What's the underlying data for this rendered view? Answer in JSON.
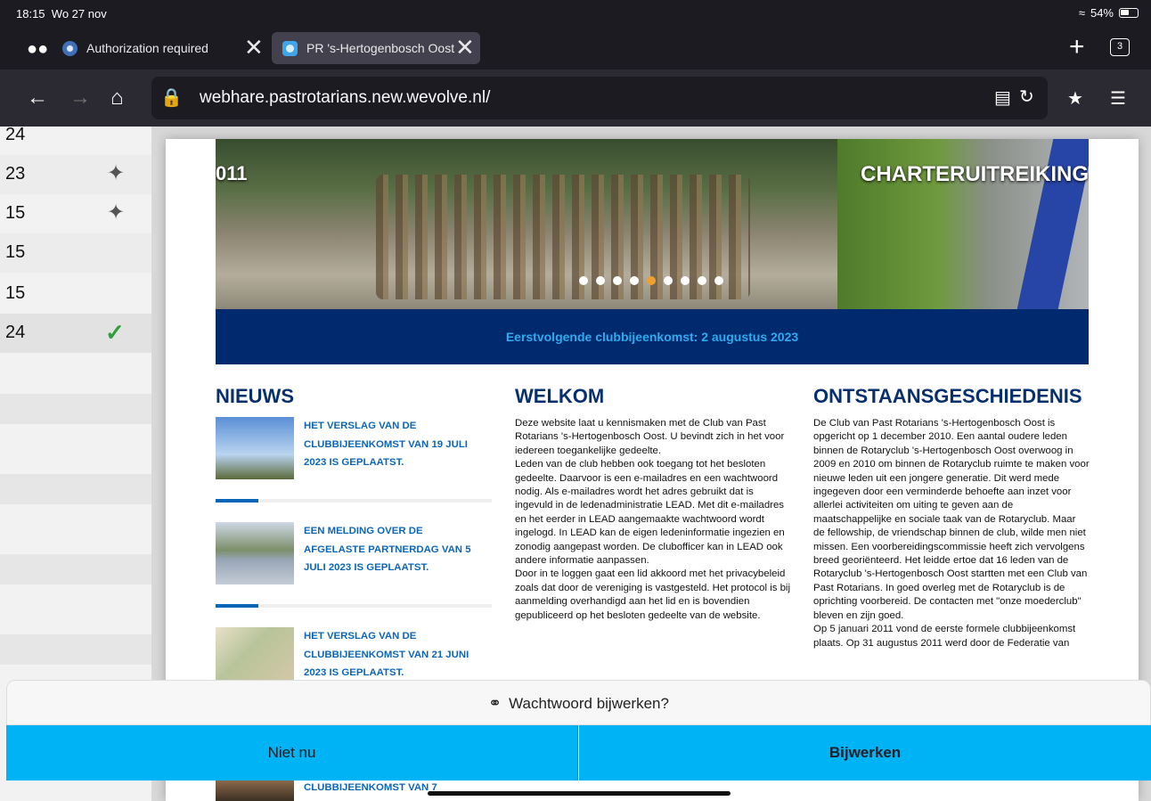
{
  "status": {
    "time": "18:15",
    "date": "Wo 27 nov",
    "battery": "54%"
  },
  "tabs": [
    {
      "label": "Authorization required"
    },
    {
      "label": "PR 's-Hertogenbosch Oost"
    }
  ],
  "tab_count": "3",
  "toolbar": {
    "url": "webhare.pastrotarians.new.wevolve.nl/"
  },
  "sidebar": {
    "rows": [
      {
        "num": "24",
        "icon": ""
      },
      {
        "num": "23",
        "icon": "pin-icon"
      },
      {
        "num": "15",
        "icon": "pin-icon"
      },
      {
        "num": "15",
        "icon": ""
      },
      {
        "num": "15",
        "icon": ""
      },
      {
        "num": "24",
        "icon": "check-icon"
      }
    ]
  },
  "hero": {
    "left_text": "011",
    "right_text": "CHARTERUITREIKING",
    "slide_count": 9,
    "active_slide": 5
  },
  "banner": "Eerstvolgende clubbijeenkomst: 2 augustus 2023",
  "news": {
    "heading": "NIEUWS",
    "items": [
      {
        "title": "HET VERSLAG VAN DE CLUBBIJEENKOMST VAN 19 JULI 2023 IS GEPLAATST."
      },
      {
        "title": "EEN MELDING OVER DE AFGELASTE PARTNERDAG VAN 5 JULI 2023 IS GEPLAATST."
      },
      {
        "title": "HET VERSLAG VAN DE CLUBBIJEENKOMST VAN 21 JUNI 2023 IS GEPLAATST."
      },
      {
        "title": "CLUBBIJEENKOMST VAN 7"
      }
    ]
  },
  "welcome": {
    "heading": "WELKOM",
    "paragraphs": [
      "Deze website laat u kennismaken met de Club van Past Rotarians 's-Hertogenbosch Oost. U bevindt zich in het voor iedereen toegankelijke gedeelte.",
      "Leden van de club hebben ook toegang tot het besloten gedeelte. Daarvoor is  een e-mailadres en een wachtwoord nodig. Als e-mailadres wordt het adres gebruikt dat is ingevuld in de ledenadministratie LEAD. Met dit e-mailadres  en het eerder in LEAD aangemaakte wachtwoord wordt ingelogd. In LEAD kan de eigen ledeninformatie ingezien en zonodig aangepast worden. De clubofficer kan in LEAD ook andere informatie aanpassen.",
      "Door in te loggen gaat een lid akkoord met het privacybeleid zoals dat door de vereniging is vastgesteld. Het protocol is bij aanmelding overhandigd aan het lid en is bovendien gepubliceerd op het besloten gedeelte van de website."
    ]
  },
  "history": {
    "heading": "ONTSTAANSGESCHIEDENIS",
    "paragraphs": [
      "De Club van Past Rotarians 's-Hertogenbosch Oost is opgericht op 1 december 2010. Een aantal oudere leden binnen de Rotaryclub 's-Hertogenbosch Oost overwoog in 2009 en 2010 om binnen de Rotaryclub ruimte te maken voor nieuwe leden uit een jongere generatie. Dit werd mede ingegeven door een verminderde behoefte aan inzet voor allerlei activiteiten om uiting te geven aan de maatschappelijke en sociale taak van de Rotaryclub. Maar de fellowship, de vriendschap binnen de club, wilde men niet missen. Een voorbereidingscommissie heeft zich vervolgens breed georiënteerd. Het leidde ertoe dat 16 leden van de Rotaryclub 's-Hertogenbosch Oost startten met een Club van Past Rotarians. In goed overleg met de Rotaryclub is de oprichting voorbereid. De contacten met \"onze moederclub\" bleven en zijn goed.",
      "Op 5 januari 2011 vond de eerste formele clubbijeenkomst plaats. Op 31 augustus 2011 werd door de Federatie van"
    ]
  },
  "password_sheet": {
    "prompt": "Wachtwoord bijwerken?",
    "not_now": "Niet nu",
    "update": "Bijwerken"
  }
}
